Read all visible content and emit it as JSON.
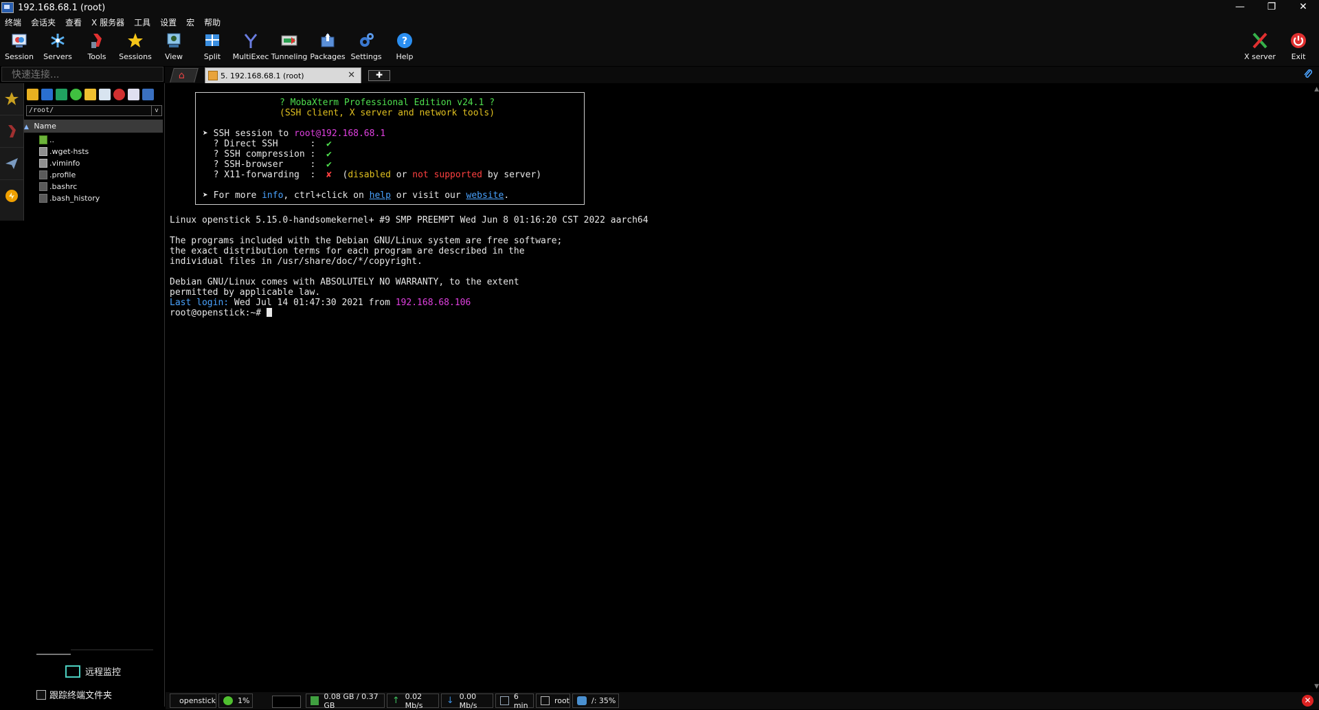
{
  "window": {
    "title": "192.168.68.1 (root)",
    "minimize": "—",
    "restore": "❐",
    "close": "✕"
  },
  "menu": [
    "终端",
    "会话夹",
    "查看",
    "X 服务器",
    "工具",
    "设置",
    "宏",
    "帮助"
  ],
  "toolbar": {
    "buttons": [
      {
        "label": "Session",
        "icon": "session-icon"
      },
      {
        "label": "Servers",
        "icon": "servers-icon"
      },
      {
        "label": "Tools",
        "icon": "tools-icon"
      },
      {
        "label": "Sessions",
        "icon": "star-icon"
      },
      {
        "label": "View",
        "icon": "view-icon"
      },
      {
        "label": "Split",
        "icon": "split-icon"
      },
      {
        "label": "MultiExec",
        "icon": "multiexec-icon"
      },
      {
        "label": "Tunneling",
        "icon": "tunneling-icon"
      },
      {
        "label": "Packages",
        "icon": "packages-icon"
      },
      {
        "label": "Settings",
        "icon": "gear-icon"
      },
      {
        "label": "Help",
        "icon": "help-icon"
      }
    ],
    "right": [
      {
        "label": "X server",
        "icon": "xserver-icon"
      },
      {
        "label": "Exit",
        "icon": "power-icon"
      }
    ]
  },
  "quick_connect": {
    "placeholder": "快速连接..."
  },
  "tabs": {
    "session_tab": "5. 192.168.68.1 (root)",
    "close": "✕",
    "add": "✚"
  },
  "sftp": {
    "path": "/root/",
    "column_header": "Name",
    "files": [
      "..",
      ".wget-hsts",
      ".viminfo",
      ".profile",
      ".bashrc",
      ".bash_history"
    ],
    "remote_monitor": "远程监控",
    "follow_terminal": "跟踪终端文件夹"
  },
  "terminal": {
    "banner_title": "? MobaXterm Professional Edition v24.1 ?",
    "banner_subtitle": "(SSH client, X server and network tools)",
    "ssh_session_prefix": "➤ SSH session to ",
    "ssh_session_target": "root@192.168.68.1",
    "direct_ssh": "  ? Direct SSH      :  ",
    "ssh_compression": "  ? SSH compression :  ",
    "ssh_browser": "  ? SSH-browser     :  ",
    "x11_forwarding": "  ? X11-forwarding  :  ",
    "check": "✔",
    "cross": "✘",
    "x11_open": "  (",
    "x11_disabled": "disabled",
    "x11_or": " or ",
    "x11_not_supported": "not supported",
    "x11_by_server": " by server)",
    "more_prefix": "➤ For more ",
    "more_info": "info",
    "more_mid": ", ctrl+click on ",
    "more_help": "help",
    "more_visit": " or visit our ",
    "more_website": "website",
    "more_end": ".",
    "uname": "Linux openstick 5.15.0-handsomekernel+ #9 SMP PREEMPT Wed Jun 8 01:16:20 CST 2022 aarch64",
    "motd1": "The programs included with the Debian GNU/Linux system are free software;",
    "motd2": "the exact distribution terms for each program are described in the",
    "motd3": "individual files in /usr/share/doc/*/copyright.",
    "warranty1": "Debian GNU/Linux comes with ABSOLUTELY NO WARRANTY, to the extent",
    "warranty2": "permitted by applicable law.",
    "last_login_label": "Last login:",
    "last_login_time": " Wed Jul 14 01:47:30 2021 from ",
    "last_login_ip": "192.168.68.106",
    "prompt": "root@openstick:~# "
  },
  "status_bar": {
    "host": "openstick",
    "cpu": "1%",
    "memory": "0.08 GB / 0.37 GB",
    "upload": "0.02 Mb/s",
    "download": "0.00 Mb/s",
    "uptime": "6 min",
    "user": "root",
    "disk": "/: 35%"
  }
}
